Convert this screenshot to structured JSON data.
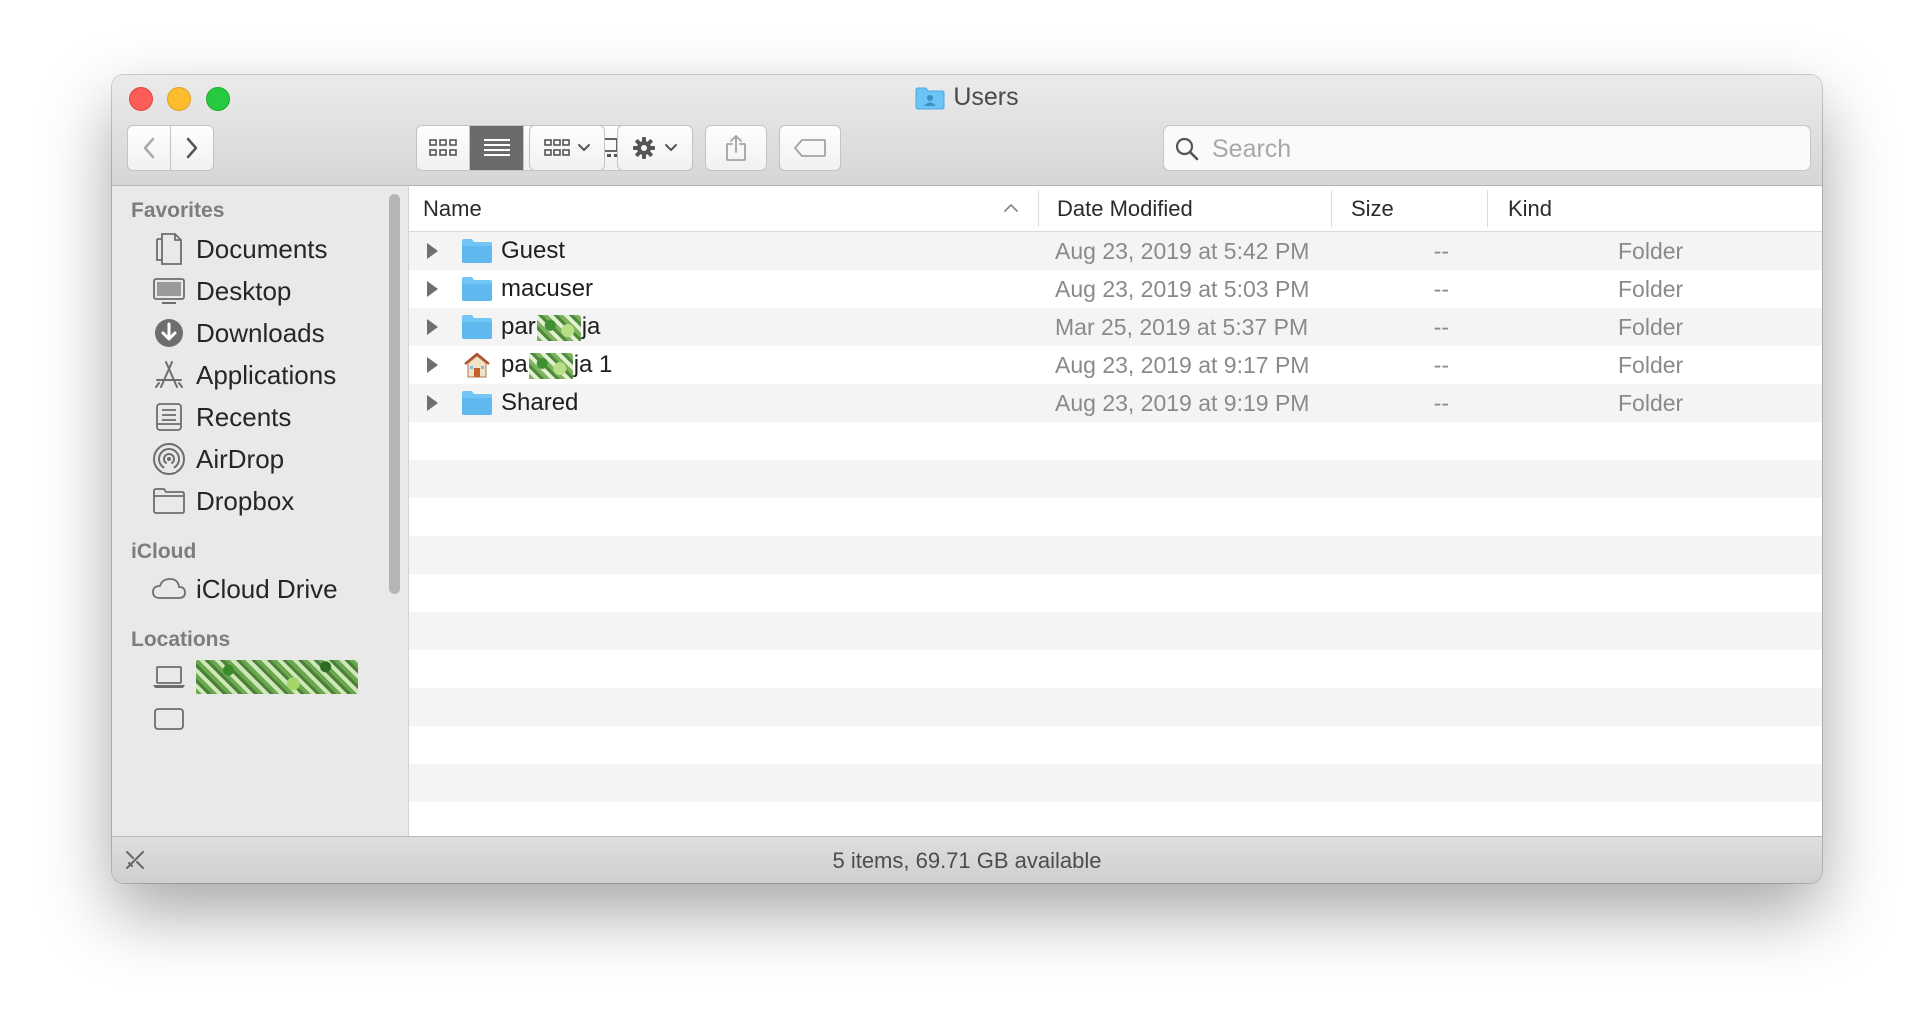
{
  "window": {
    "title": "Users"
  },
  "toolbar": {
    "search_placeholder": "Search"
  },
  "sidebar": {
    "favorites_label": "Favorites",
    "favorites": [
      {
        "label": "Documents",
        "icon": "documents-icon"
      },
      {
        "label": "Desktop",
        "icon": "desktop-icon"
      },
      {
        "label": "Downloads",
        "icon": "downloads-icon"
      },
      {
        "label": "Applications",
        "icon": "applications-icon"
      },
      {
        "label": "Recents",
        "icon": "recents-icon"
      },
      {
        "label": "AirDrop",
        "icon": "airdrop-icon"
      },
      {
        "label": "Dropbox",
        "icon": "folder-icon"
      }
    ],
    "icloud_label": "iCloud",
    "icloud": [
      {
        "label": "iCloud Drive",
        "icon": "cloud-icon"
      }
    ],
    "locations_label": "Locations",
    "locations": [
      {
        "label": "",
        "icon": "laptop-icon",
        "redacted": true
      }
    ]
  },
  "columns": {
    "name": "Name",
    "date_modified": "Date Modified",
    "size": "Size",
    "kind": "Kind"
  },
  "files": [
    {
      "name": "Guest",
      "date": "Aug 23, 2019 at 5:42 PM",
      "size": "--",
      "kind": "Folder",
      "icon": "folder-icon"
    },
    {
      "name": "macuser",
      "date": "Aug 23, 2019 at 5:03 PM",
      "size": "--",
      "kind": "Folder",
      "icon": "folder-icon"
    },
    {
      "name_prefix": "par",
      "name_suffix": "ja",
      "date": "Mar 25, 2019 at 5:37 PM",
      "size": "--",
      "kind": "Folder",
      "icon": "folder-icon"
    },
    {
      "name_prefix": "pa",
      "name_suffix": "ja 1",
      "date": "Aug 23, 2019 at 9:17 PM",
      "size": "--",
      "kind": "Folder",
      "icon": "home-icon"
    },
    {
      "name": "Shared",
      "date": "Aug 23, 2019 at 9:19 PM",
      "size": "--",
      "kind": "Folder",
      "icon": "folder-icon"
    }
  ],
  "status": {
    "text": "5 items, 69.71 GB available"
  },
  "colors": {
    "folder_blue": "#6cc4f5",
    "selected_segment": "#6b6b6b",
    "close": "#fc5d57",
    "minimize": "#fdbb2e",
    "maximize": "#27c940"
  }
}
